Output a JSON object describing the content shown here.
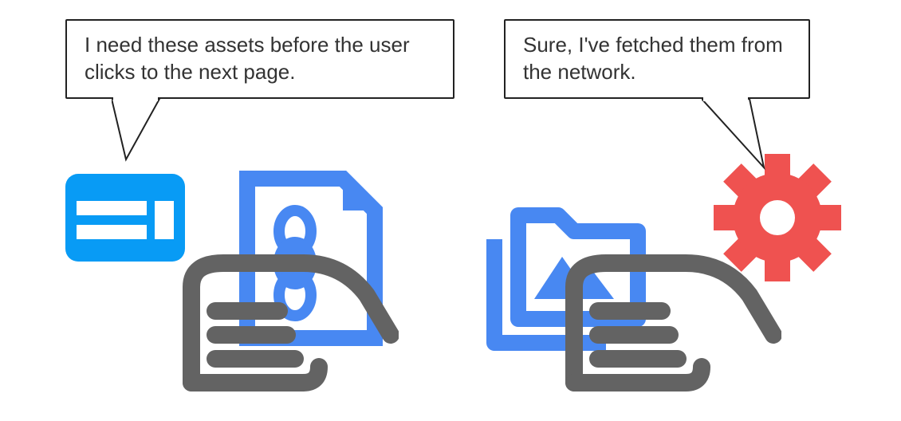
{
  "speech": {
    "left": "I need these assets before the user clicks to the next page.",
    "right": "Sure, I've fetched them from the network."
  },
  "icons": {
    "webpage": "webpage-layout-icon",
    "hand_left": "hand-holding-icon",
    "file_chain": "file-link-icon",
    "folder_image": "folder-image-icon",
    "hand_right": "hand-holding-icon",
    "gear": "gear-icon"
  },
  "colors": {
    "bright_blue": "#089BF5",
    "mid_blue": "#4888F2",
    "grey": "#636363",
    "red": "#EF5250",
    "white": "#ffffff"
  }
}
